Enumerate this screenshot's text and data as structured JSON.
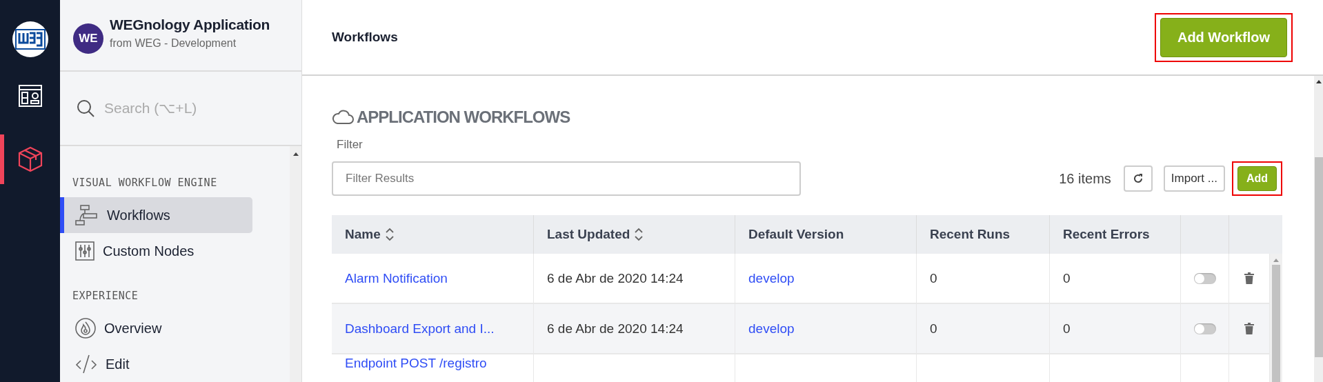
{
  "rail_items": [
    {
      "kind": "dashboard",
      "selected": false
    },
    {
      "kind": "application",
      "selected": true
    }
  ],
  "app": {
    "initials": "WE",
    "name": "WEGnology Application",
    "subtitle": "from WEG - Development"
  },
  "sidebar": {
    "search": {
      "placeholder": "Search (⌥+L)"
    },
    "sections": [
      {
        "title": "VISUAL WORKFLOW ENGINE",
        "items": [
          {
            "kind": "workflow",
            "label": "Workflows",
            "selected": true
          },
          {
            "kind": "nodes",
            "label": "Custom Nodes",
            "selected": false
          }
        ]
      },
      {
        "title": "EXPERIENCE",
        "items": [
          {
            "kind": "overview",
            "label": "Overview",
            "selected": false
          },
          {
            "kind": "edit",
            "label": "Edit",
            "selected": false
          }
        ]
      }
    ]
  },
  "header": {
    "title": "Workflows",
    "button": {
      "label": "Add Workflow",
      "highlighted": true
    }
  },
  "section_title": "APPLICATION WORKFLOWS",
  "filter": {
    "label": "Filter",
    "placeholder": "Filter Results"
  },
  "toolbar": {
    "count": "16 items",
    "import_label": "Import ...",
    "add": {
      "label": "Add",
      "highlighted": true
    }
  },
  "table": {
    "columns": [
      {
        "label": "Name",
        "sortable": true
      },
      {
        "label": "Last Updated",
        "sortable": true
      },
      {
        "label": "Default Version",
        "sortable": false
      },
      {
        "label": "Recent Runs",
        "sortable": false
      },
      {
        "label": "Recent Errors",
        "sortable": false
      }
    ],
    "rows": [
      {
        "name": "Alarm Notification",
        "updated": "6 de Abr de 2020 14:24",
        "version": "develop",
        "runs": "0",
        "errors": "0",
        "on": false
      },
      {
        "name": "Dashboard Export and I...",
        "updated": "6 de Abr de 2020 14:24",
        "version": "develop",
        "runs": "0",
        "errors": "0",
        "on": false
      },
      {
        "name": "Endpoint POST /registro"
      }
    ]
  }
}
